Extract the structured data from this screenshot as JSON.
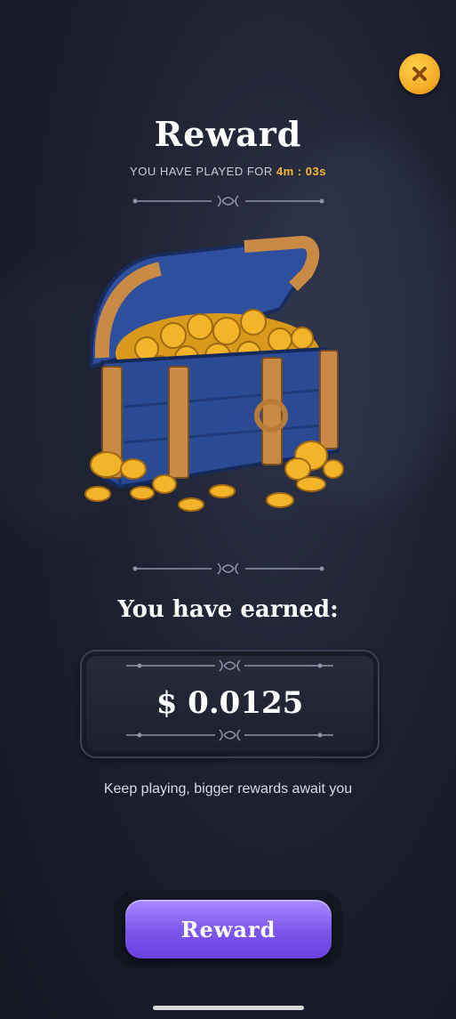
{
  "header": {
    "title": "Reward",
    "played_label": "YOU HAVE PLAYED FOR",
    "played_time": "4m : 03s"
  },
  "close": {
    "icon": "close-icon",
    "color": "#f2a623"
  },
  "earned": {
    "label": "You have earned:",
    "amount": "$ 0.0125"
  },
  "message": "Keep playing, bigger rewards await you",
  "button": {
    "label": "Reward",
    "color": "#7c56ec"
  },
  "colors": {
    "accent": "#f4b933",
    "background": "#1c2030"
  }
}
